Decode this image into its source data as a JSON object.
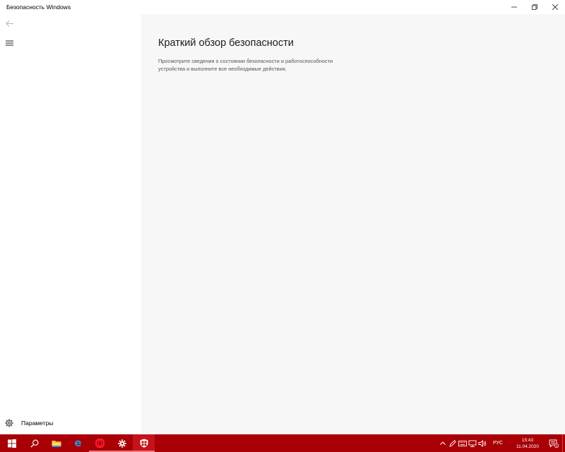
{
  "window": {
    "title": "Безопасность Windows",
    "controls": {
      "minimize": "minimize-icon",
      "maximize": "restore-icon",
      "close": "close-icon"
    }
  },
  "nav": {
    "back_icon": "back-arrow-icon",
    "menu_icon": "hamburger-menu-icon",
    "settings_label": "Параметры",
    "settings_icon": "gear-icon"
  },
  "main": {
    "title": "Краткий обзор безопасности",
    "description": "Просмотрите сведения о состоянии безопасности и работоспособности устройства и выполните все необходимые действия."
  },
  "taskbar": {
    "apps": [
      "windows-start-icon",
      "search-icon",
      "file-explorer-icon",
      "edge-icon",
      "opera-icon",
      "settings-icon",
      "windows-security-icon"
    ],
    "tray": {
      "language": "РУС",
      "time": "15:43",
      "date": "11.04.2020",
      "notification_count": "1"
    },
    "colors": {
      "taskbar": "#a80005",
      "active": "#c6121a"
    }
  }
}
